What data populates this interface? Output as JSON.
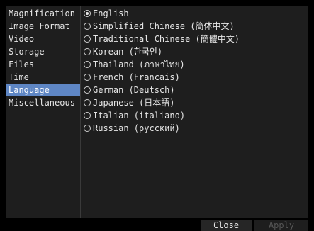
{
  "sidebar": {
    "items": [
      {
        "label": "Magnification"
      },
      {
        "label": "Image Format"
      },
      {
        "label": "Video"
      },
      {
        "label": "Storage"
      },
      {
        "label": "Files"
      },
      {
        "label": "Time"
      },
      {
        "label": "Language"
      },
      {
        "label": "Miscellaneous"
      }
    ],
    "selected": "Language"
  },
  "language": {
    "options": [
      {
        "label": "English"
      },
      {
        "label": "Simplified Chinese (简体中文)"
      },
      {
        "label": "Traditional Chinese (簡體中文)"
      },
      {
        "label": "Korean (한국인)"
      },
      {
        "label": "Thailand (ภาษาไทย)"
      },
      {
        "label": "French (Francais)"
      },
      {
        "label": "German (Deutsch)"
      },
      {
        "label": "Japanese (日本語)"
      },
      {
        "label": "Italian (italiano)"
      },
      {
        "label": "Russian (русский)"
      }
    ],
    "selected": "English"
  },
  "footer": {
    "close_label": "Close",
    "apply_label": "Apply"
  },
  "colors": {
    "selection": "#5e86c4",
    "panel": "#1e1e1e",
    "text": "#e6e6e6",
    "disabled_text": "#555555"
  }
}
